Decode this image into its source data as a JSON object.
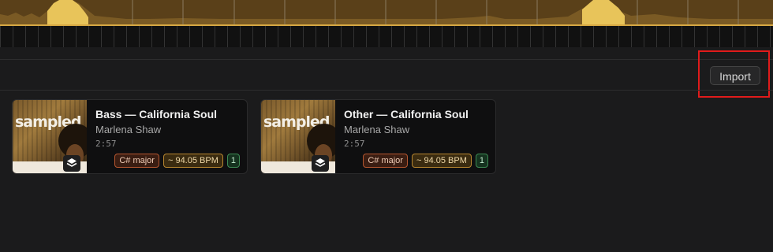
{
  "toolbar": {
    "import_label": "Import"
  },
  "colors": {
    "waveform_fill": "#5a4019",
    "waveform_line": "#d6a843",
    "highlight_box": "#e01b1b",
    "key_badge_border": "#b5562f",
    "bpm_badge_border": "#b8862f",
    "count_badge_border": "#3d8a54"
  },
  "cards": [
    {
      "title": "Bass — California Soul",
      "artist": "Marlena Shaw",
      "duration": "2:57",
      "key": "C# major",
      "bpm": "~ 94.05 BPM",
      "count": "1",
      "art_title": "sampled",
      "icon": "layers-icon"
    },
    {
      "title": "Other — California Soul",
      "artist": "Marlena Shaw",
      "duration": "2:57",
      "key": "C# major",
      "bpm": "~ 94.05 BPM",
      "count": "1",
      "art_title": "sampled",
      "icon": "layers-icon"
    }
  ]
}
